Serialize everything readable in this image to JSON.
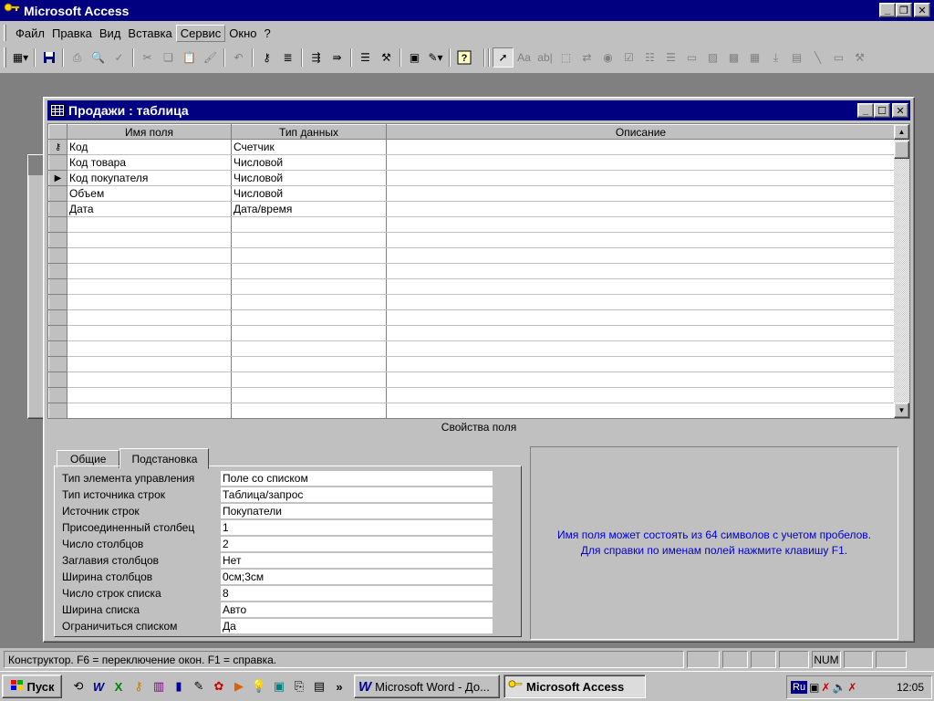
{
  "app": {
    "title": "Microsoft Access"
  },
  "menu": [
    "Файл",
    "Правка",
    "Вид",
    "Вставка",
    "Сервис",
    "Окно",
    "?"
  ],
  "menu_active_index": 4,
  "toolbar": {
    "icons": [
      "view-icon",
      "save-icon",
      "print-icon",
      "print-preview-icon",
      "spelling-icon",
      "cut-icon",
      "copy-icon",
      "paste-icon",
      "format-painter-icon",
      "undo-icon",
      "primary-key-icon",
      "indexes-icon",
      "insert-rows-icon",
      "delete-rows-icon",
      "properties-icon",
      "build-icon",
      "database-window-icon",
      "new-object-icon",
      "help-icon",
      "select-objects-icon",
      "label-icon",
      "text-box-icon",
      "option-group-icon",
      "toggle-button-icon",
      "option-button-icon",
      "check-box-icon",
      "combo-box-icon",
      "list-box-icon",
      "command-button-icon",
      "image-icon",
      "unbound-object-icon",
      "bound-object-icon",
      "page-break-icon",
      "subform-icon",
      "line-icon",
      "rectangle-icon",
      "more-controls-icon"
    ]
  },
  "table_window": {
    "title": "Продажи : таблица",
    "columns": [
      "Имя поля",
      "Тип данных",
      "Описание"
    ],
    "rows": [
      {
        "field": "Код",
        "type": "Счетчик",
        "desc": "",
        "marker": "key"
      },
      {
        "field": "Код товара",
        "type": "Числовой",
        "desc": "",
        "marker": ""
      },
      {
        "field": "Код покупателя",
        "type": "Числовой",
        "desc": "",
        "marker": "current"
      },
      {
        "field": "Объем",
        "type": "Числовой",
        "desc": "",
        "marker": ""
      },
      {
        "field": "Дата",
        "type": "Дата/время",
        "desc": "",
        "marker": ""
      }
    ],
    "empty_rows": 13,
    "field_properties_label": "Свойства поля",
    "tabs": [
      "Общие",
      "Подстановка"
    ],
    "active_tab": 1,
    "properties": [
      {
        "name": "Тип элемента управления",
        "value": "Поле со списком"
      },
      {
        "name": "Тип источника строк",
        "value": "Таблица/запрос"
      },
      {
        "name": "Источник строк",
        "value": "Покупатели"
      },
      {
        "name": "Присоединенный столбец",
        "value": "1"
      },
      {
        "name": "Число столбцов",
        "value": "2"
      },
      {
        "name": "Заглавия столбцов",
        "value": "Нет"
      },
      {
        "name": "Ширина столбцов",
        "value": "0см;3см"
      },
      {
        "name": "Число строк списка",
        "value": "8"
      },
      {
        "name": "Ширина списка",
        "value": "Авто"
      },
      {
        "name": "Ограничиться списком",
        "value": "Да"
      }
    ],
    "help_line1": "Имя поля может состоять из 64 символов с учетом пробелов.",
    "help_line2": "Для справки по именам полей нажмите клавишу F1."
  },
  "status": {
    "message": "Конструктор.  F6 = переключение окон.  F1 = справка.",
    "num": "NUM"
  },
  "taskbar": {
    "start": "Пуск",
    "tasks": [
      {
        "label": "Microsoft Word - До...",
        "icon": "word-icon",
        "active": false
      },
      {
        "label": "Microsoft Access",
        "icon": "access-key-icon",
        "active": true
      }
    ],
    "lang": "Ru",
    "clock": "12:05"
  },
  "colors": {
    "title_active": "#000080",
    "face": "#c0c0c0",
    "help_text": "#0000d0"
  }
}
